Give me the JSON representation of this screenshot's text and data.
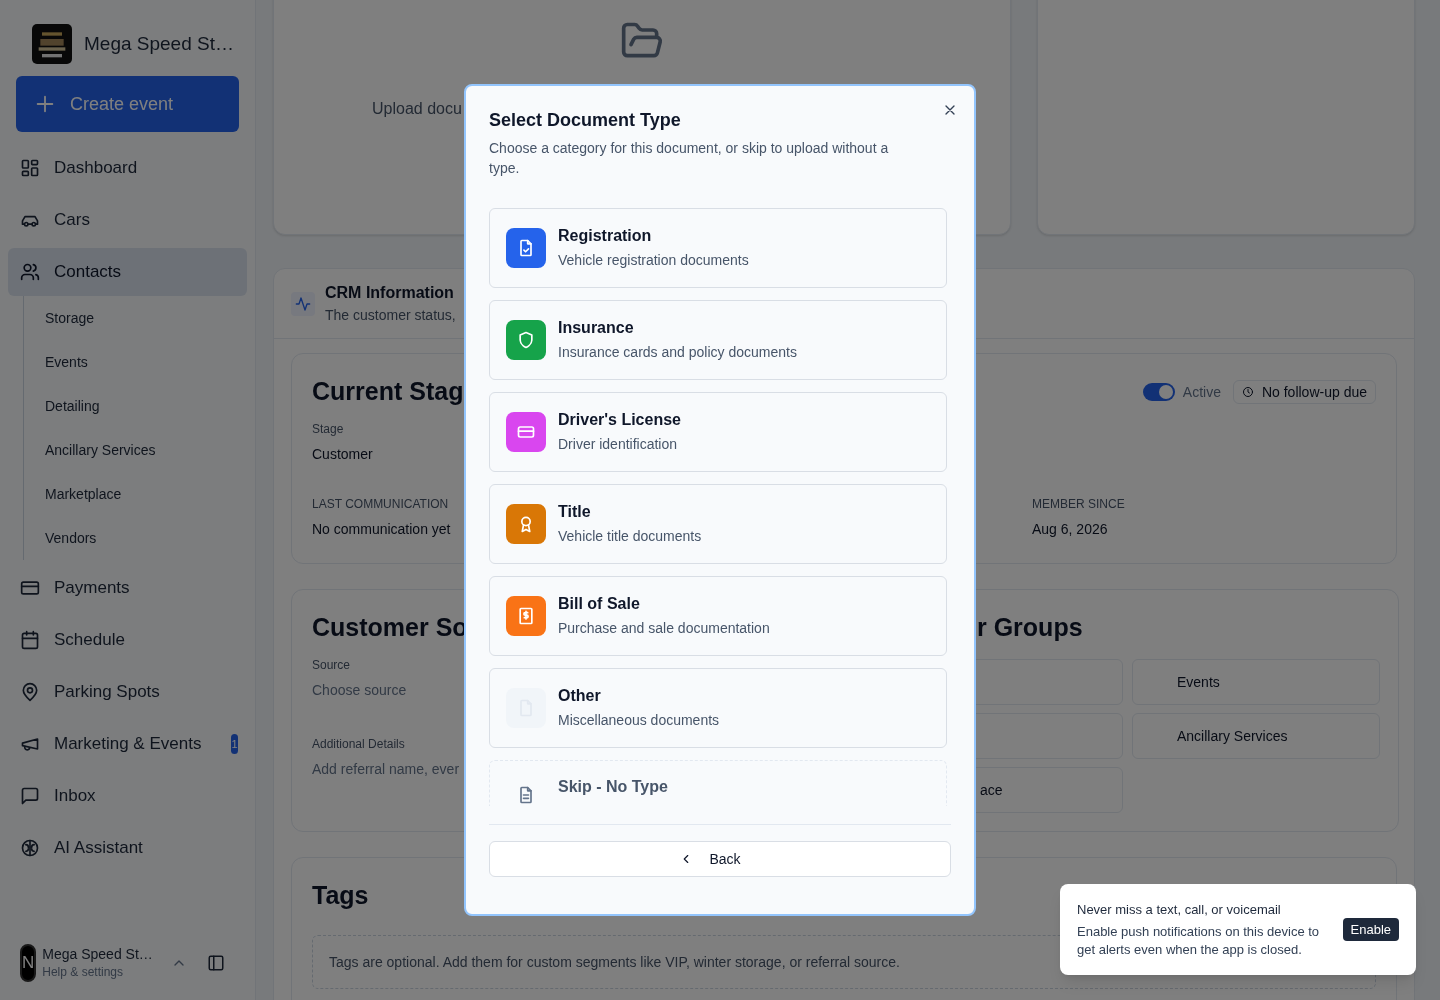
{
  "sidebar": {
    "brand": "Mega Speed St…",
    "create_button": "Create event",
    "items": [
      {
        "label": "Dashboard",
        "selected": false
      },
      {
        "label": "Cars",
        "selected": false
      },
      {
        "label": "Contacts",
        "selected": true,
        "children": [
          {
            "label": "Storage",
            "selected": false
          },
          {
            "label": "Events",
            "selected": false
          },
          {
            "label": "Detailing",
            "selected": false
          },
          {
            "label": "Ancillary Services",
            "selected": false
          },
          {
            "label": "Marketplace",
            "selected": false
          },
          {
            "label": "Vendors",
            "selected": false
          }
        ]
      },
      {
        "label": "Payments",
        "selected": false
      },
      {
        "label": "Schedule",
        "selected": false
      },
      {
        "label": "Parking Spots",
        "selected": false
      },
      {
        "label": "Marketing & Events",
        "selected": false,
        "badge": "1"
      },
      {
        "label": "Inbox",
        "selected": false
      },
      {
        "label": "AI Assistant",
        "selected": false
      }
    ],
    "user": {
      "initial": "N",
      "name": "Mega Speed St…",
      "subtitle": "Help & settings"
    }
  },
  "main": {
    "upload_card": {
      "label": "Upload docu"
    },
    "crm": {
      "title": "CRM Information",
      "subtitle": "The customer status,",
      "current_stage": {
        "title": "Current Stag",
        "toggle": {
          "label": "Active",
          "on": true
        },
        "follow_up": "No follow-up due",
        "stage_label": "Stage",
        "stage_value": "Customer",
        "last_comm_label": "LAST COMMUNICATION",
        "last_comm_value": "No communication yet",
        "member_label": "MEMBER SINCE",
        "member_value": "Aug 6, 2026"
      },
      "source": {
        "title": "Customer So",
        "source_label": "Source",
        "source_placeholder": "Choose source",
        "details_label": "Additional Details",
        "details_placeholder": "Add referral name, ever"
      },
      "groups": {
        "title": "r Groups",
        "items": [
          {
            "label": "Events"
          },
          {
            "label": "Ancillary Services"
          },
          {
            "label": "ace"
          }
        ]
      },
      "tags": {
        "title": "Tags",
        "hint": "Tags are optional. Add them for custom segments like VIP, winter storage, or referral source."
      }
    }
  },
  "modal": {
    "title": "Select Document Type",
    "description": "Choose a category for this document, or skip to upload without a type.",
    "options": [
      {
        "kind": "type",
        "title": "Registration",
        "subtitle": "Vehicle registration documents",
        "color": "#2563eb"
      },
      {
        "kind": "type",
        "title": "Insurance",
        "subtitle": "Insurance cards and policy documents",
        "color": "#16a34a"
      },
      {
        "kind": "type",
        "title": "Driver's License",
        "subtitle": "Driver identification",
        "color": "#d946ef"
      },
      {
        "kind": "type",
        "title": "Title",
        "subtitle": "Vehicle title documents",
        "color": "#d97706"
      },
      {
        "kind": "type",
        "title": "Bill of Sale",
        "subtitle": "Purchase and sale documentation",
        "color": "#f97316"
      },
      {
        "kind": "type",
        "title": "Other",
        "subtitle": "Miscellaneous documents",
        "color": "#f1f5f9"
      },
      {
        "kind": "skip",
        "title": "Skip - No Type"
      }
    ],
    "back_button": "Back"
  },
  "toast": {
    "title": "Never miss a text, call, or voicemail",
    "body": "Enable push notifications on this device to get alerts even when the app is closed.",
    "button": "Enable"
  }
}
